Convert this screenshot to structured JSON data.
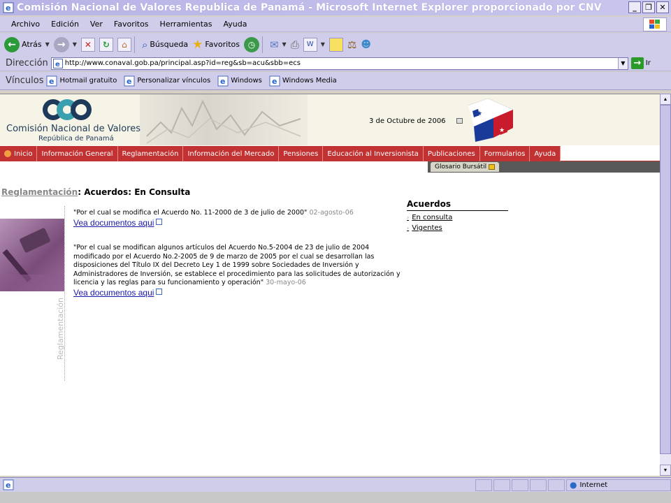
{
  "window": {
    "title": "Comisión Nacional de Valores Republica de Panamá - Microsoft Internet Explorer proporcionado por CNV",
    "buttons": [
      "_",
      "❐",
      "✕"
    ]
  },
  "menu": [
    "Archivo",
    "Edición",
    "Ver",
    "Favoritos",
    "Herramientas",
    "Ayuda"
  ],
  "toolbar": {
    "back_label": "Atrás",
    "search_label": "Búsqueda",
    "favorites_label": "Favoritos"
  },
  "address": {
    "label": "Dirección",
    "url": "http://www.conaval.gob.pa/principal.asp?id=reg&sb=acu&sbb=ecs",
    "go_label": "Ir"
  },
  "links": {
    "label": "Vínculos",
    "items": [
      "Hotmail gratuito",
      "Personalizar vínculos",
      "Windows",
      "Windows Media"
    ]
  },
  "site": {
    "logo_name": "Comisión Nacional de Valores",
    "logo_sub": "República de Panamá",
    "date": "3 de Octubre de 2006",
    "nav": [
      "Inicio",
      "Información General",
      "Reglamentación",
      "Información del Mercado",
      "Pensiones",
      "Educación al Inversionista",
      "Publicaciones",
      "Formularios",
      "Ayuda"
    ],
    "glosario": "Glosario Bursátil",
    "side_label": "Reglamentación"
  },
  "heading": {
    "crumb": "Reglamentación",
    "sep1": ":",
    "section": "Acuerdos",
    "sep2": ":",
    "page": "En Consulta"
  },
  "entries": [
    {
      "text": "\"Por el cual se modifica el Acuerdo No. 11-2000 de 3 de julio de 2000\"",
      "date": "02-agosto-06",
      "link": "Vea documentos aqui"
    },
    {
      "text": "\"Por el cual se modifican algunos artículos del Acuerdo No.5-2004 de 23 de julio de 2004 modificado por el Acuerdo No.2-2005 de 9 de marzo de 2005 por el cual se desarrollan las disposiciones del Título IX del Decreto Ley 1 de 1999 sobre Sociedades de Inversión y Administradores de Inversión, se establece el procedimiento para las solicitudes de autorización y licencia y las reglas para su funcionamiento y operación\"",
      "date": "30-mayo-06",
      "link": "Vea documentos aqui"
    }
  ],
  "sidebar": {
    "title": "Acuerdos",
    "items": [
      "En consulta",
      "Vigentes"
    ]
  },
  "status": {
    "zone": "Internet"
  },
  "colors": {
    "nav_red": "#c23232",
    "chrome_lilac": "#d0cdea",
    "link_blue": "#1a1aa6"
  }
}
